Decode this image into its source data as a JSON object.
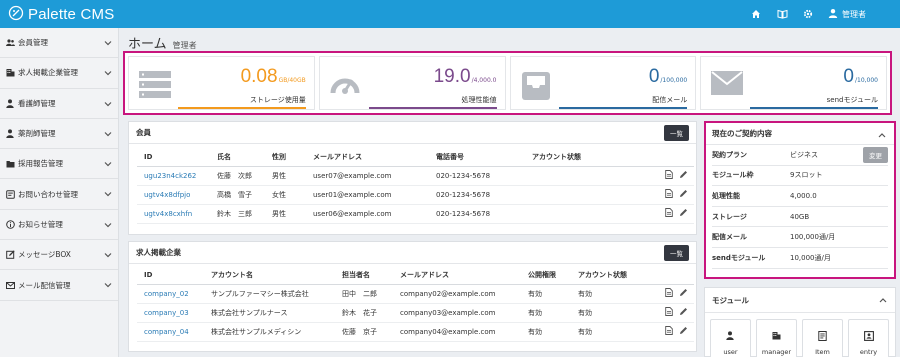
{
  "app": {
    "name": "Palette CMS",
    "user_label": "管理者"
  },
  "sidebar": {
    "items": [
      {
        "label": "会員管理",
        "icon": "users-icon"
      },
      {
        "label": "求人掲載企業管理",
        "icon": "building-icon"
      },
      {
        "label": "看護師管理",
        "icon": "user-icon"
      },
      {
        "label": "薬剤師管理",
        "icon": "user-icon"
      },
      {
        "label": "採用報告管理",
        "icon": "folder-icon"
      },
      {
        "label": "お問い合わせ管理",
        "icon": "message-icon"
      },
      {
        "label": "お知らせ管理",
        "icon": "info-icon"
      },
      {
        "label": "メッセージBOX",
        "icon": "edit-icon"
      },
      {
        "label": "メール配信管理",
        "icon": "mail-icon"
      }
    ]
  },
  "page": {
    "title": "ホーム",
    "subtitle": "管理者"
  },
  "stats": [
    {
      "value": "0.08",
      "unit": "GB/40GB",
      "label": "ストレージ使用量",
      "color": "#f39a1e",
      "icon": "storage-icon"
    },
    {
      "value": "19.0",
      "unit": "/4,000.0",
      "label": "処理性能値",
      "color": "#7b4a8c",
      "icon": "gauge-icon"
    },
    {
      "value": "0",
      "unit": "/100,000",
      "label": "配信メール",
      "color": "#2a6aa0",
      "icon": "inbox-icon"
    },
    {
      "value": "0",
      "unit": "/10,000",
      "label": "sendモジュール",
      "color": "#2a6aa0",
      "icon": "envelope-icon"
    }
  ],
  "members": {
    "title": "会員",
    "button": "一覧",
    "columns": [
      "ID",
      "氏名",
      "性別",
      "メールアドレス",
      "電話番号",
      "アカウント状態"
    ],
    "rows": [
      [
        "ugu23n4ck262",
        "佐藤　次郎",
        "男性",
        "user07@example.com",
        "020-1234-5678",
        ""
      ],
      [
        "ugtv4x8dfpjo",
        "高橋　雪子",
        "女性",
        "user01@example.com",
        "020-1234-5678",
        ""
      ],
      [
        "ugtv4x8cxhfn",
        "鈴木　三郎",
        "男性",
        "user06@example.com",
        "020-1234-5678",
        ""
      ]
    ]
  },
  "companies": {
    "title": "求人掲載企業",
    "button": "一覧",
    "columns": [
      "ID",
      "アカウント名",
      "担当者名",
      "メールアドレス",
      "公開権限",
      "アカウント状態"
    ],
    "rows": [
      [
        "company_02",
        "サンプルファーマシー株式会社",
        "田中　二郎",
        "company02@example.com",
        "有効",
        "有効"
      ],
      [
        "company_03",
        "株式会社サンプルナース",
        "鈴木　花子",
        "company03@example.com",
        "有効",
        "有効"
      ],
      [
        "company_04",
        "株式会社サンプルメディシン",
        "佐藤　京子",
        "company04@example.com",
        "有効",
        "有効"
      ]
    ]
  },
  "contract": {
    "title": "現在のご契約内容",
    "change_button": "変更",
    "rows": [
      {
        "label": "契約プラン",
        "value": "ビジネス"
      },
      {
        "label": "モジュール枠",
        "value": "9スロット"
      },
      {
        "label": "処理性能",
        "value": "4,000.0"
      },
      {
        "label": "ストレージ",
        "value": "40GB"
      },
      {
        "label": "配信メール",
        "value": "100,000通/月"
      },
      {
        "label": "sendモジュール",
        "value": "10,000通/月"
      }
    ]
  },
  "module": {
    "title": "モジュール",
    "tiles": [
      {
        "label": "user",
        "icon": "user-icon"
      },
      {
        "label": "manager",
        "icon": "building-icon"
      },
      {
        "label": "Item",
        "icon": "document-icon"
      },
      {
        "label": "entry",
        "icon": "id-card-icon"
      }
    ]
  },
  "colors": {
    "topbar": "#1e9bd7",
    "highlight": "#c8157e",
    "link": "#2a7bb5"
  }
}
